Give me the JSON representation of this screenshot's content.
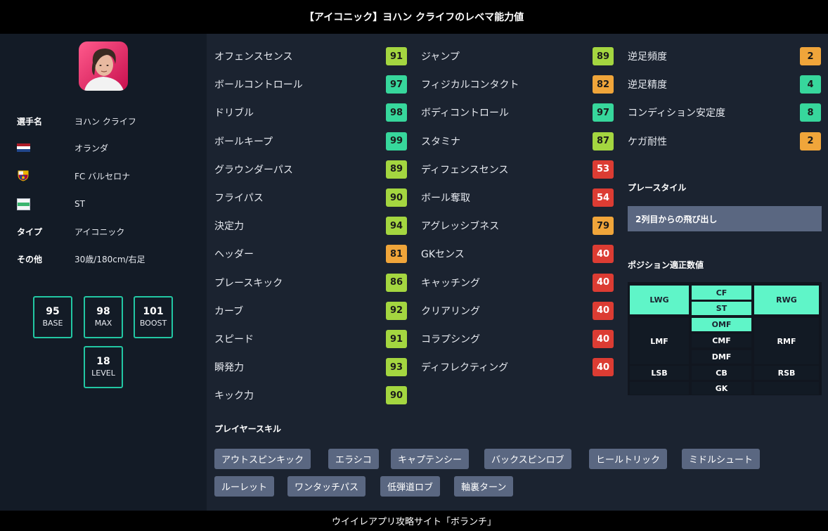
{
  "header": {
    "title": "【アイコニック】ヨハン クライフのレベマ能力値"
  },
  "footer": {
    "text": "ウイイレアプリ攻略サイト「ボランチ」"
  },
  "profile": {
    "name_label": "選手名",
    "name": "ヨハン クライフ",
    "nationality": "オランダ",
    "club": "FC バルセロナ",
    "position": "ST",
    "type_label": "タイプ",
    "type": "アイコニック",
    "other_label": "その他",
    "other": "30歳/180cm/右足",
    "flag_colors": [
      "#ae1c28",
      "#ffffff",
      "#21468b"
    ]
  },
  "levels": {
    "base": {
      "value": "95",
      "label": "BASE"
    },
    "max": {
      "value": "98",
      "label": "MAX"
    },
    "boost": {
      "value": "101",
      "label": "BOOST"
    },
    "level": {
      "value": "18",
      "label": "LEVEL"
    }
  },
  "stats_col1": [
    {
      "name": "オフェンスセンス",
      "value": "91",
      "tier": "green"
    },
    {
      "name": "ボールコントロール",
      "value": "97",
      "tier": "teal"
    },
    {
      "name": "ドリブル",
      "value": "98",
      "tier": "teal"
    },
    {
      "name": "ボールキープ",
      "value": "99",
      "tier": "teal"
    },
    {
      "name": "グラウンダーパス",
      "value": "89",
      "tier": "green"
    },
    {
      "name": "フライパス",
      "value": "90",
      "tier": "green"
    },
    {
      "name": "決定力",
      "value": "94",
      "tier": "green"
    },
    {
      "name": "ヘッダー",
      "value": "81",
      "tier": "orange"
    },
    {
      "name": "プレースキック",
      "value": "86",
      "tier": "green"
    },
    {
      "name": "カーブ",
      "value": "92",
      "tier": "green"
    },
    {
      "name": "スピード",
      "value": "91",
      "tier": "green"
    },
    {
      "name": "瞬発力",
      "value": "93",
      "tier": "green"
    },
    {
      "name": "キック力",
      "value": "90",
      "tier": "green"
    }
  ],
  "stats_col2": [
    {
      "name": "ジャンプ",
      "value": "89",
      "tier": "green"
    },
    {
      "name": "フィジカルコンタクト",
      "value": "82",
      "tier": "orange"
    },
    {
      "name": "ボディコントロール",
      "value": "97",
      "tier": "teal"
    },
    {
      "name": "スタミナ",
      "value": "87",
      "tier": "green"
    },
    {
      "name": "ディフェンスセンス",
      "value": "53",
      "tier": "red"
    },
    {
      "name": "ボール奪取",
      "value": "54",
      "tier": "red"
    },
    {
      "name": "アグレッシブネス",
      "value": "79",
      "tier": "orange"
    },
    {
      "name": "GKセンス",
      "value": "40",
      "tier": "red"
    },
    {
      "name": "キャッチング",
      "value": "40",
      "tier": "red"
    },
    {
      "name": "クリアリング",
      "value": "40",
      "tier": "red"
    },
    {
      "name": "コラプシング",
      "value": "40",
      "tier": "red"
    },
    {
      "name": "ディフレクティング",
      "value": "40",
      "tier": "red"
    }
  ],
  "stats_col3": [
    {
      "name": "逆足頻度",
      "value": "2",
      "tier": "orange"
    },
    {
      "name": "逆足精度",
      "value": "4",
      "tier": "teal"
    },
    {
      "name": "コンディション安定度",
      "value": "8",
      "tier": "teal"
    },
    {
      "name": "ケガ耐性",
      "value": "2",
      "tier": "orange"
    }
  ],
  "playstyle": {
    "title": "プレースタイル",
    "value": "2列目からの飛び出し"
  },
  "positions": {
    "title": "ポジション適正数値",
    "cells": [
      {
        "label": "LWG",
        "hl": true
      },
      {
        "label": "CF",
        "hl": true
      },
      {
        "label": "ST",
        "hl": true
      },
      {
        "label": "RWG",
        "hl": true
      },
      {
        "label": "OMF",
        "hl": true
      },
      {
        "label": "LMF",
        "hl": false
      },
      {
        "label": "CMF",
        "hl": false
      },
      {
        "label": "RMF",
        "hl": false
      },
      {
        "label": "DMF",
        "hl": false
      },
      {
        "label": "LSB",
        "hl": false
      },
      {
        "label": "CB",
        "hl": false
      },
      {
        "label": "RSB",
        "hl": false
      },
      {
        "label": "",
        "hl": false
      },
      {
        "label": "GK",
        "hl": false
      },
      {
        "label": "",
        "hl": false
      }
    ]
  },
  "skills": {
    "title": "プレイヤースキル",
    "items": [
      "アウトスピンキック",
      "エラシコ",
      "キャプテンシー",
      "バックスピンロブ",
      "ヒールトリック",
      "ミドルシュート",
      "ルーレット",
      "ワンタッチパス",
      "低弾道ロブ",
      "軸裏ターン"
    ]
  },
  "tier_colors": {
    "green": "#a4d640",
    "teal": "#37d79c",
    "orange": "#f0a53a",
    "red": "#dc3c33"
  }
}
